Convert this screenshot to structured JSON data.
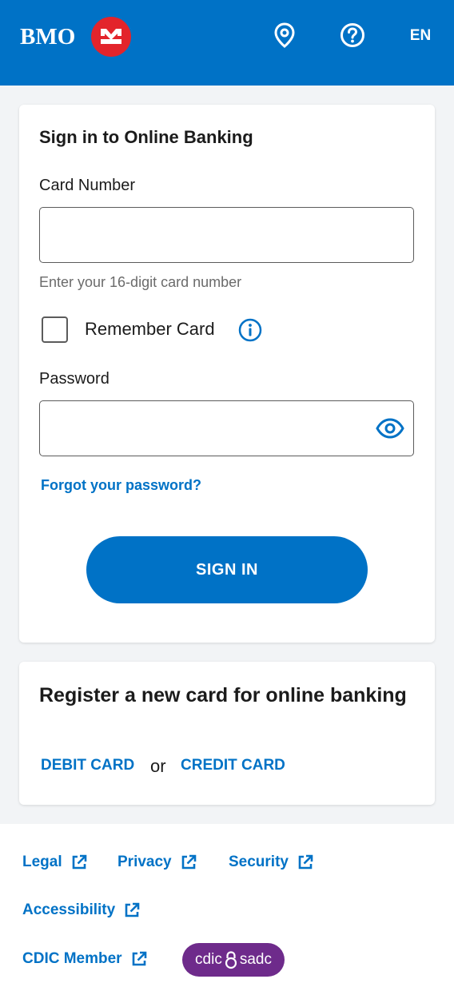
{
  "header": {
    "logo_text": "BMO",
    "language": "EN",
    "icons": {
      "location": "location-pin-icon",
      "help": "help-circle-icon"
    },
    "colors": {
      "brand_blue": "#0072c6",
      "logo_red": "#e3242b"
    }
  },
  "signin": {
    "title": "Sign in to Online Banking",
    "card_number_label": "Card Number",
    "card_number_value": "",
    "card_number_placeholder": "",
    "card_number_hint": "Enter your 16-digit card number",
    "remember_card_label": "Remember Card",
    "remember_card_checked": false,
    "password_label": "Password",
    "password_value": "",
    "password_placeholder": "",
    "forgot_password": "Forgot your password?",
    "signin_button": "SIGN IN"
  },
  "register": {
    "title": "Register a new card for online banking",
    "debit_card": "DEBIT CARD",
    "or": "or",
    "credit_card": "CREDIT CARD"
  },
  "footer": {
    "links": {
      "legal": "Legal",
      "privacy": "Privacy",
      "security": "Security",
      "accessibility": "Accessibility",
      "cdic_member": "CDIC Member"
    },
    "cdic_badge": {
      "left": "cdic",
      "right": "sadc",
      "color": "#6e2b8b"
    }
  }
}
